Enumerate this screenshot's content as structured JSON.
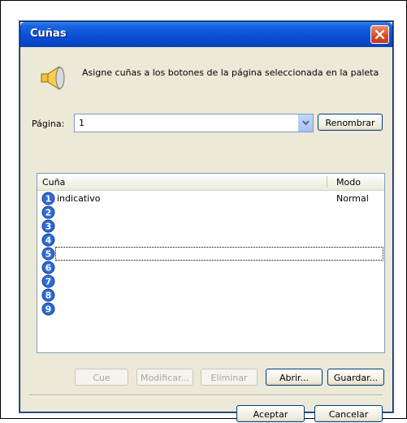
{
  "window": {
    "title": "Cuñas"
  },
  "instructions": "Asigne cuñas a los botones de la página seleccionada en la paleta",
  "page": {
    "label": "Página:",
    "value": "1"
  },
  "buttons": {
    "rename": "Renombrar",
    "cue": "Cue",
    "modify": "Modificar...",
    "delete": "Eliminar",
    "open": "Abrir...",
    "save": "Guardar...",
    "ok": "Aceptar",
    "cancel": "Cancelar"
  },
  "list": {
    "columns": [
      "Cuña",
      "Modo"
    ],
    "rows": [
      {
        "num": "1",
        "label": "indicativo",
        "mode": "Normal"
      },
      {
        "num": "2",
        "label": "",
        "mode": ""
      },
      {
        "num": "3",
        "label": "",
        "mode": ""
      },
      {
        "num": "4",
        "label": "",
        "mode": ""
      },
      {
        "num": "5",
        "label": "",
        "mode": ""
      },
      {
        "num": "6",
        "label": "",
        "mode": ""
      },
      {
        "num": "7",
        "label": "",
        "mode": ""
      },
      {
        "num": "8",
        "label": "",
        "mode": ""
      },
      {
        "num": "9",
        "label": "",
        "mode": ""
      }
    ],
    "focused_row": 5
  },
  "icons": {
    "title_close": "close-icon",
    "speaker": "speaker-icon",
    "dropdown": "chevron-down-icon",
    "row_badge": "number-badge-icon"
  },
  "colors": {
    "titlebar": "#0a4fd6",
    "badge": "#2c6bd8",
    "close": "#d8492a"
  }
}
